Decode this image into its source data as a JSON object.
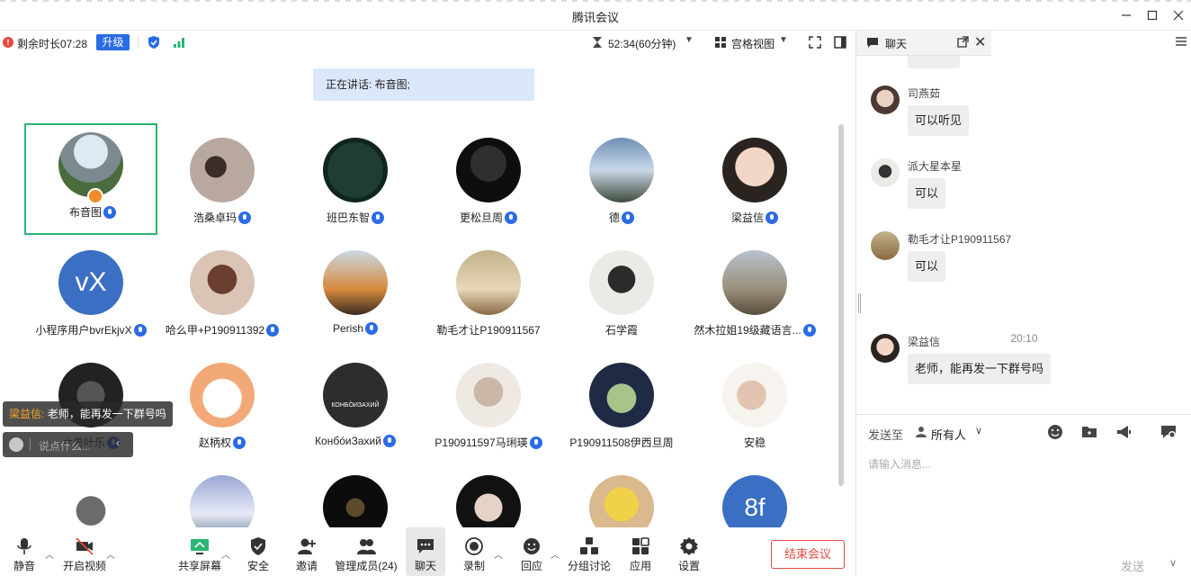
{
  "window": {
    "title": "腾讯会议"
  },
  "top": {
    "remaining": "剩余时长07:28",
    "upgrade": "升级",
    "timer": "52:34(60分钟)",
    "view": "宫格视图"
  },
  "speaking": "正在讲话: 布音图;",
  "participants": [
    {
      "name": "布音图",
      "mic": true,
      "host": true
    },
    {
      "name": "浩桑卓玛",
      "mic": true
    },
    {
      "name": "班巴东智",
      "mic": true
    },
    {
      "name": "更松旦周",
      "mic": true
    },
    {
      "name": "德",
      "mic": true
    },
    {
      "name": "梁益信",
      "mic": true
    },
    {
      "name": "小程序用户bvrEkjvX",
      "mic": true,
      "avatar_text": "vX"
    },
    {
      "name": "哈么甲+P190911392",
      "mic": true
    },
    {
      "name": "Perish",
      "mic": true
    },
    {
      "name": "勒毛才让P190911567",
      "mic": false
    },
    {
      "name": "石学霞",
      "mic": false
    },
    {
      "name": "然木拉姐19级藏语言...",
      "mic": true
    },
    {
      "name": "木希叶乐",
      "mic": true
    },
    {
      "name": "赵柄权",
      "mic": true
    },
    {
      "name": "Конбо́иЗахий",
      "mic": true,
      "avatar_text": "КОНБО̀ИЗАХИЙ"
    },
    {
      "name": "P190911597马琍瑛",
      "mic": true
    },
    {
      "name": "P190911508伊西旦周",
      "mic": false
    },
    {
      "name": "安稳",
      "mic": false
    },
    {
      "name": "",
      "mic": false
    },
    {
      "name": "",
      "mic": false
    },
    {
      "name": "",
      "mic": false
    },
    {
      "name": "",
      "mic": false
    },
    {
      "name": "",
      "mic": false
    },
    {
      "name": "",
      "mic": false,
      "avatar_text": "8f"
    }
  ],
  "toast": {
    "who": "梁益信:",
    "message": "老师，能再发一下群号吗"
  },
  "quick_chat": {
    "placeholder": "说点什么..."
  },
  "bottom": {
    "mute": "静音",
    "video": "开启视频",
    "share": "共享屏幕",
    "security": "安全",
    "invite": "邀请",
    "members": "管理成员(24)",
    "chat": "聊天",
    "record": "录制",
    "react": "回应",
    "breakout": "分组讨论",
    "apps": "应用",
    "settings": "设置",
    "end": "结束会议"
  },
  "chat": {
    "title": "聊天",
    "messages": [
      {
        "sender": "司燕茹",
        "text": "可以听见"
      },
      {
        "sender": "派大星本星",
        "text": "可以"
      },
      {
        "sender": "勒毛才让P190911567",
        "text": "可以"
      },
      {
        "sender": "梁益信",
        "text": "老师，能再发一下群号吗"
      }
    ],
    "time_divider": "20:10",
    "send_to_label": "发送至",
    "recipient": "所有人",
    "input_placeholder": "请输入消息...",
    "send": "发送"
  },
  "colors": {
    "accent": "#2a6be6",
    "end": "#e5483d",
    "speaking_bg": "#dbe8fa",
    "active_border": "#2bb673"
  }
}
